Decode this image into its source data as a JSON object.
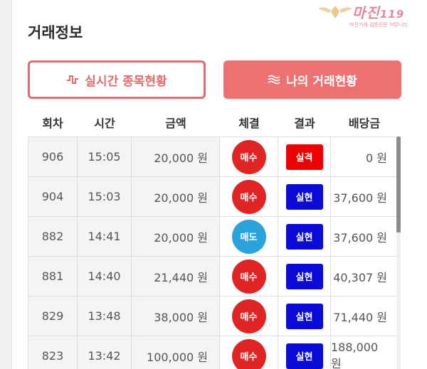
{
  "page": {
    "title": "거래정보"
  },
  "watermark": {
    "logo": "마진",
    "logo_suffix": "119",
    "sub": "마진거래 검증전문 커뮤니티"
  },
  "buttons": {
    "realtime": {
      "label": "실시간 종목현황",
      "icon": "pulse-icon"
    },
    "mytrade": {
      "label": "나의 거래현황",
      "icon": "waves-icon"
    }
  },
  "table": {
    "headers": [
      "회차",
      "시간",
      "금액",
      "체결",
      "결과",
      "배당금"
    ],
    "rows": [
      {
        "round": "906",
        "time": "15:05",
        "amount": "20,000 원",
        "trade": "매수",
        "result": "실격",
        "payout": "0 원"
      },
      {
        "round": "904",
        "time": "15:03",
        "amount": "20,000 원",
        "trade": "매수",
        "result": "실현",
        "payout": "37,600 원"
      },
      {
        "round": "882",
        "time": "14:41",
        "amount": "20,000 원",
        "trade": "매도",
        "result": "실현",
        "payout": "37,600 원"
      },
      {
        "round": "881",
        "time": "14:40",
        "amount": "21,440 원",
        "trade": "매수",
        "result": "실현",
        "payout": "40,307 원"
      },
      {
        "round": "829",
        "time": "13:48",
        "amount": "38,000 원",
        "trade": "매수",
        "result": "실현",
        "payout": "71,440 원"
      },
      {
        "round": "823",
        "time": "13:42",
        "amount": "100,000 원",
        "trade": "매수",
        "result": "실현",
        "payout": "188,000 원"
      }
    ]
  },
  "colors": {
    "accent": "#ee7172",
    "buy": "#e02424",
    "sell": "#2aa3dc",
    "realized": "#0b0bd8",
    "disqualified": "#ee0000"
  }
}
